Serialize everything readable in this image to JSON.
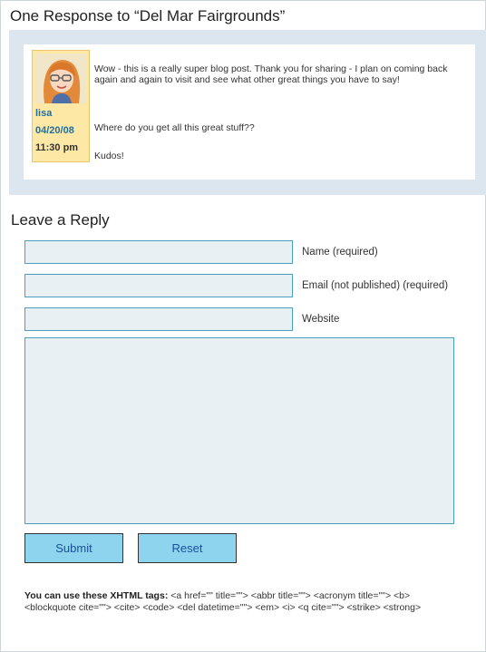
{
  "responses": {
    "title": "One Response to “Del Mar Fairgrounds”"
  },
  "comment": {
    "author": "lisa",
    "date": "04/20/08",
    "time": "11:30 pm",
    "paragraphs": [
      "Wow - this is a really super blog post. Thank you for sharing - I plan on coming back again and again to visit and see what other great things you have to say!",
      "Where do you get all this great stuff??",
      "Kudos!"
    ]
  },
  "reply": {
    "title": "Leave a Reply",
    "name_label": "Name (required)",
    "email_label": "Email (not published) (required)",
    "website_label": "Website",
    "name_value": "",
    "email_value": "",
    "website_value": "",
    "comment_value": "",
    "submit_label": "Submit",
    "reset_label": "Reset",
    "tags_heading": "You can use these XHTML tags:",
    "tags_list": "<a href=\"\" title=\"\"> <abbr title=\"\"> <acronym title=\"\"> <b> <blockquote cite=\"\"> <cite> <code> <del datetime=\"\"> <em> <i> <q cite=\"\"> <strike> <strong>"
  },
  "colors": {
    "comments_bg": "#dbe6ee",
    "author_bg": "#fde8a6",
    "field_border": "#4a9fbf",
    "field_bg": "#e8f0f3",
    "button_bg": "#8fd4ee",
    "button_text": "#1a4f9a",
    "author_link": "#1f6f9f"
  }
}
